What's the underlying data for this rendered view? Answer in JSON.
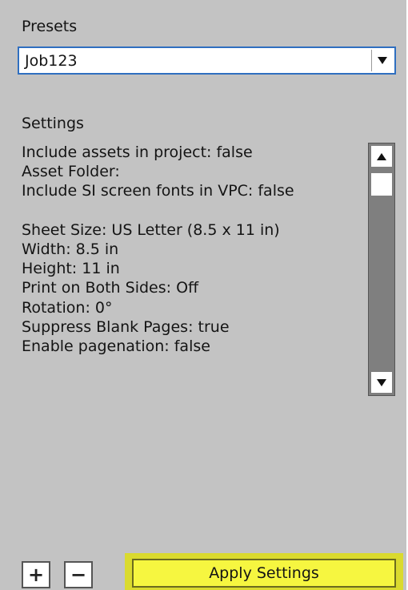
{
  "presets": {
    "label": "Presets",
    "selected": "Job123"
  },
  "settings": {
    "label": "Settings",
    "lines": [
      "Include assets in project: false",
      "Asset Folder:",
      "Include SI screen fonts in VPC: false",
      "",
      "Sheet Size: US Letter (8.5 x 11 in)",
      "Width: 8.5 in",
      "Height: 11 in",
      "Print on Both Sides: Off",
      "Rotation: 0°",
      "Suppress Blank Pages: true",
      "Enable pagenation: false"
    ]
  },
  "buttons": {
    "add": "+",
    "remove": "−",
    "apply": "Apply Settings"
  },
  "colors": {
    "panel_bg": "#c3c3c3",
    "dropdown_border": "#2f6fc0",
    "apply_fill": "#f6f640",
    "apply_highlight": "#dada2e"
  },
  "icons": {
    "dropdown": "chevron-down-icon",
    "scroll_up": "arrow-up-icon",
    "scroll_down": "arrow-down-icon"
  }
}
